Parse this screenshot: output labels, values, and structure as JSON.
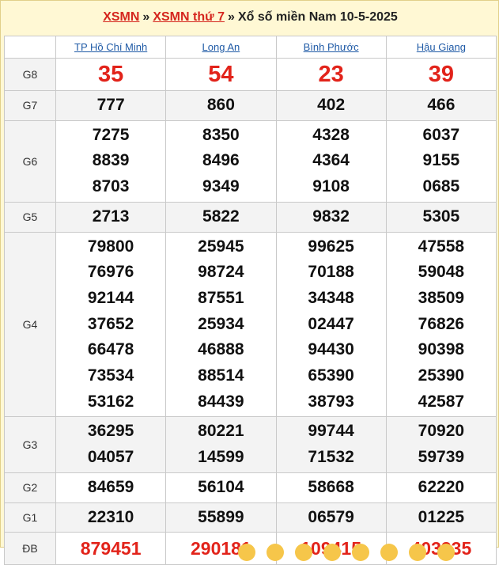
{
  "breadcrumb": {
    "link1": "XSMN",
    "link2": "XSMN thứ 7",
    "separator": "»",
    "text": "Xổ số miền Nam 10-5-2025"
  },
  "provinces": [
    "TP Hồ Chí Minh",
    "Long An",
    "Bình Phước",
    "Hậu Giang"
  ],
  "prizes": [
    {
      "label": "G8",
      "style": "big",
      "values": [
        [
          "35"
        ],
        [
          "54"
        ],
        [
          "23"
        ],
        [
          "39"
        ]
      ]
    },
    {
      "label": "G7",
      "style": "normal",
      "values": [
        [
          "777"
        ],
        [
          "860"
        ],
        [
          "402"
        ],
        [
          "466"
        ]
      ]
    },
    {
      "label": "G6",
      "style": "normal",
      "values": [
        [
          "7275",
          "8839",
          "8703"
        ],
        [
          "8350",
          "8496",
          "9349"
        ],
        [
          "4328",
          "4364",
          "9108"
        ],
        [
          "6037",
          "9155",
          "0685"
        ]
      ]
    },
    {
      "label": "G5",
      "style": "normal",
      "values": [
        [
          "2713"
        ],
        [
          "5822"
        ],
        [
          "9832"
        ],
        [
          "5305"
        ]
      ]
    },
    {
      "label": "G4",
      "style": "normal",
      "values": [
        [
          "79800",
          "76976",
          "92144",
          "37652",
          "66478",
          "73534",
          "53162"
        ],
        [
          "25945",
          "98724",
          "87551",
          "25934",
          "46888",
          "88514",
          "84439"
        ],
        [
          "99625",
          "70188",
          "34348",
          "02447",
          "94430",
          "65390",
          "38793"
        ],
        [
          "47558",
          "59048",
          "38509",
          "76826",
          "90398",
          "25390",
          "42587"
        ]
      ]
    },
    {
      "label": "G3",
      "style": "normal",
      "values": [
        [
          "36295",
          "04057"
        ],
        [
          "80221",
          "14599"
        ],
        [
          "99744",
          "71532"
        ],
        [
          "70920",
          "59739"
        ]
      ]
    },
    {
      "label": "G2",
      "style": "normal",
      "values": [
        [
          "84659"
        ],
        [
          "56104"
        ],
        [
          "58668"
        ],
        [
          "62220"
        ]
      ]
    },
    {
      "label": "G1",
      "style": "normal",
      "values": [
        [
          "22310"
        ],
        [
          "55899"
        ],
        [
          "06579"
        ],
        [
          "01225"
        ]
      ]
    },
    {
      "label": "ĐB",
      "style": "db",
      "values": [
        [
          "879451"
        ],
        [
          "290181"
        ],
        [
          "109415"
        ],
        [
          "403335"
        ]
      ]
    }
  ],
  "colors": {
    "red": "#e2231a",
    "link": "#1f5aa6",
    "title_link": "#d5261e"
  }
}
